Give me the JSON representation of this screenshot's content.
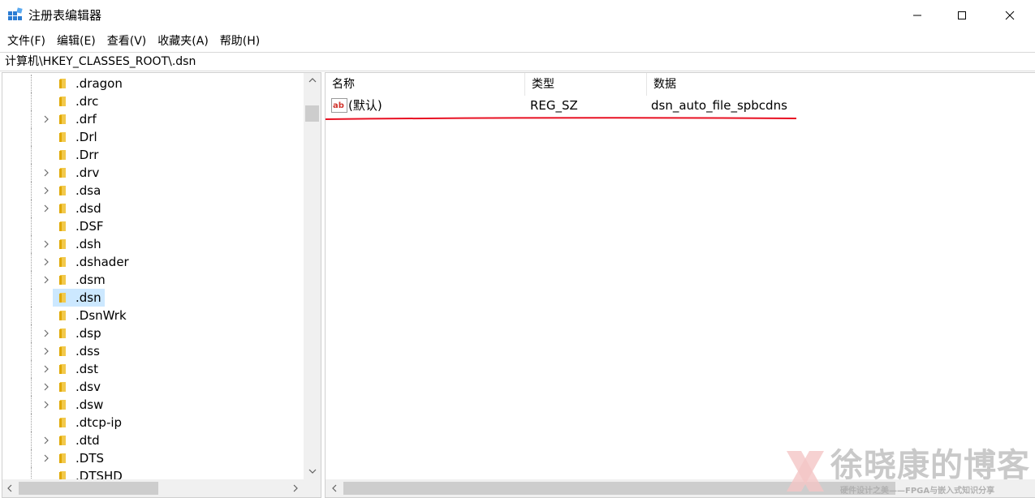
{
  "window": {
    "title": "注册表编辑器",
    "icon": "regedit-icon"
  },
  "menu": {
    "items": [
      "文件(F)",
      "编辑(E)",
      "查看(V)",
      "收藏夹(A)",
      "帮助(H)"
    ]
  },
  "address": {
    "path": "计算机\\HKEY_CLASSES_ROOT\\.dsn"
  },
  "tree": {
    "items": [
      {
        "label": ".dragon",
        "expandable": false
      },
      {
        "label": ".drc",
        "expandable": false
      },
      {
        "label": ".drf",
        "expandable": true
      },
      {
        "label": ".Drl",
        "expandable": false
      },
      {
        "label": ".Drr",
        "expandable": false
      },
      {
        "label": ".drv",
        "expandable": true
      },
      {
        "label": ".dsa",
        "expandable": true
      },
      {
        "label": ".dsd",
        "expandable": true
      },
      {
        "label": ".DSF",
        "expandable": false
      },
      {
        "label": ".dsh",
        "expandable": true
      },
      {
        "label": ".dshader",
        "expandable": true
      },
      {
        "label": ".dsm",
        "expandable": true
      },
      {
        "label": ".dsn",
        "expandable": false,
        "selected": true
      },
      {
        "label": ".DsnWrk",
        "expandable": false
      },
      {
        "label": ".dsp",
        "expandable": true
      },
      {
        "label": ".dss",
        "expandable": true
      },
      {
        "label": ".dst",
        "expandable": true
      },
      {
        "label": ".dsv",
        "expandable": true
      },
      {
        "label": ".dsw",
        "expandable": true
      },
      {
        "label": ".dtcp-ip",
        "expandable": false
      },
      {
        "label": ".dtd",
        "expandable": true
      },
      {
        "label": ".DTS",
        "expandable": true
      },
      {
        "label": ".DTSHD",
        "expandable": false
      }
    ]
  },
  "values": {
    "columns": {
      "name": "名称",
      "type": "类型",
      "data": "数据"
    },
    "rows": [
      {
        "name": "(默认)",
        "type": "REG_SZ",
        "data": "dsn_auto_file_spbcdns"
      }
    ]
  },
  "colors": {
    "selection": "#cce8ff",
    "annotation_line": "#e81123",
    "folder": "#f2c94c"
  },
  "watermark": {
    "title": "徐晓康的博客",
    "subtitle": "硬件设计之美——FPGA与嵌入式知识分享"
  }
}
